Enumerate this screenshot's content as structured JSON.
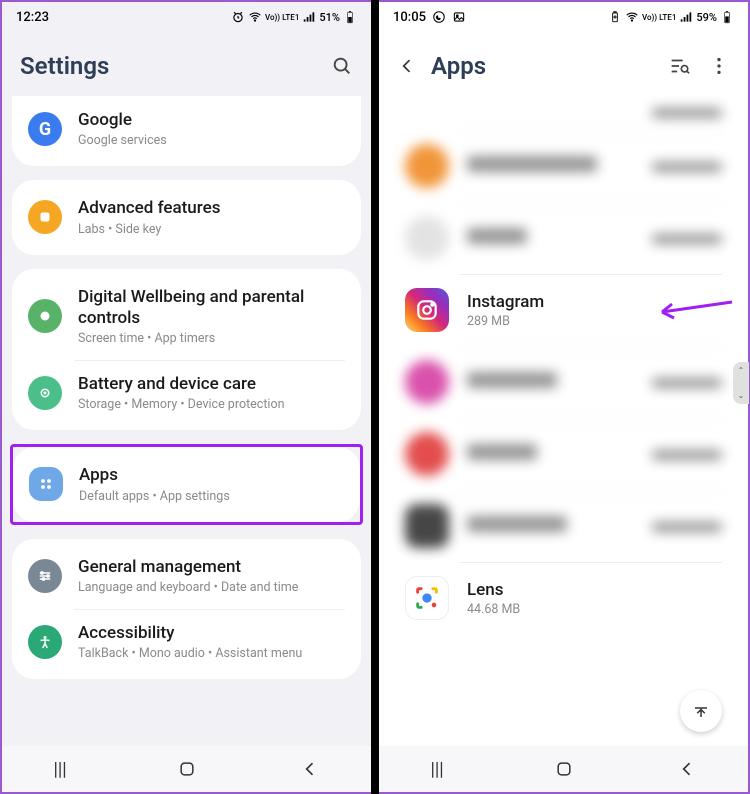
{
  "left": {
    "status": {
      "time": "12:23",
      "battery": "51%",
      "net": "Vo)) LTE1"
    },
    "header": {
      "title": "Settings"
    },
    "rows": {
      "google": {
        "title": "Google",
        "sub": "Google services",
        "color": "#3a7bf0",
        "icon": "google"
      },
      "advanced": {
        "title": "Advanced features",
        "sub": "Labs  •  Side key",
        "color": "#f5a623",
        "icon": "advanced"
      },
      "wellbeing": {
        "title": "Digital Wellbeing and parental controls",
        "sub": "Screen time  •  App timers",
        "color": "#58b368",
        "icon": "wellbeing"
      },
      "battery": {
        "title": "Battery and device care",
        "sub": "Storage  •  Memory  •  Device protection",
        "color": "#4bbf8a",
        "icon": "battery"
      },
      "apps": {
        "title": "Apps",
        "sub": "Default apps  •  App settings",
        "color": "#6fa8e6",
        "icon": "apps"
      },
      "general": {
        "title": "General management",
        "sub": "Language and keyboard  •  Date and time",
        "color": "#7a8896",
        "icon": "general"
      },
      "access": {
        "title": "Accessibility",
        "sub": "TalkBack  •  Mono audio  •  Assistant menu",
        "color": "#2aa876",
        "icon": "access"
      }
    }
  },
  "right": {
    "status": {
      "time": "10:05",
      "battery": "59%",
      "net": "Vo)) LTE1"
    },
    "header": {
      "title": "Apps"
    },
    "apps": {
      "instagram": {
        "name": "Instagram",
        "size": "289 MB"
      },
      "lens": {
        "name": "Lens",
        "size": "44.68 MB"
      }
    },
    "blurred_colors": [
      "#f08a24",
      "#e0e0e0",
      "#d63fa3",
      "#e03a3a",
      "#333"
    ]
  }
}
